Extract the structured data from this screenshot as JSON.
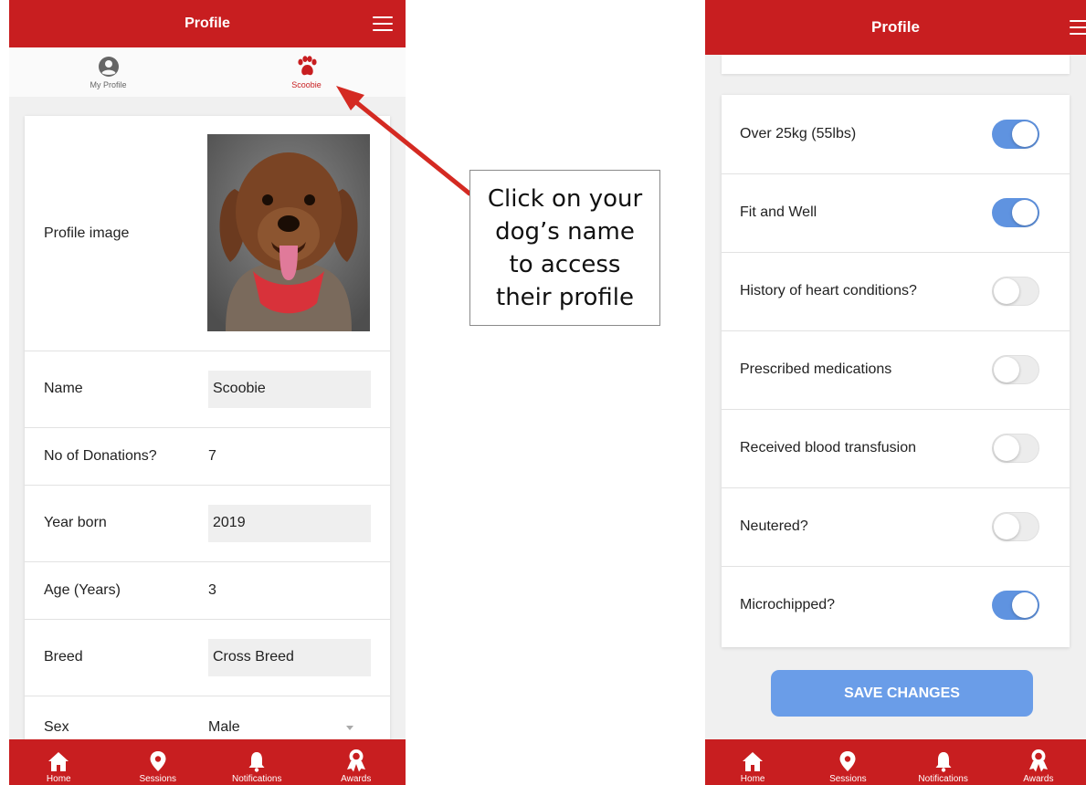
{
  "left": {
    "header": {
      "title": "Profile"
    },
    "tabs": [
      {
        "label": "My Profile"
      },
      {
        "label": "Scoobie"
      }
    ],
    "fields": {
      "profile_image": {
        "label": "Profile image"
      },
      "name": {
        "label": "Name",
        "value": "Scoobie"
      },
      "donations": {
        "label": "No of Donations?",
        "value": "7"
      },
      "year_born": {
        "label": "Year born",
        "value": "2019"
      },
      "age": {
        "label": "Age (Years)",
        "value": "3"
      },
      "breed": {
        "label": "Breed",
        "value": "Cross Breed"
      },
      "sex": {
        "label": "Sex",
        "value": "Male"
      }
    }
  },
  "callout": {
    "text": "Click on your\ndog’s name\nto access\ntheir profile"
  },
  "right": {
    "header": {
      "title": "Profile"
    },
    "toggles": [
      {
        "label": "Over 25kg (55lbs)",
        "on": true
      },
      {
        "label": "Fit and Well",
        "on": true
      },
      {
        "label": "History of heart conditions?",
        "on": false
      },
      {
        "label": "Prescribed medications",
        "on": false
      },
      {
        "label": "Received blood transfusion",
        "on": false
      },
      {
        "label": "Neutered?",
        "on": false
      },
      {
        "label": "Microchipped?",
        "on": true
      }
    ],
    "save_label": "SAVE CHANGES"
  },
  "nav": {
    "items": [
      {
        "label": "Home",
        "icon": "home-icon"
      },
      {
        "label": "Sessions",
        "icon": "location-pin-icon"
      },
      {
        "label": "Notifications",
        "icon": "bell-icon"
      },
      {
        "label": "Awards",
        "icon": "award-ribbon-icon"
      }
    ]
  },
  "colors": {
    "brand_red": "#c81e20",
    "toggle_blue": "#5f93e0",
    "button_blue": "#6a9de8",
    "arrow_red": "#d42a22"
  }
}
